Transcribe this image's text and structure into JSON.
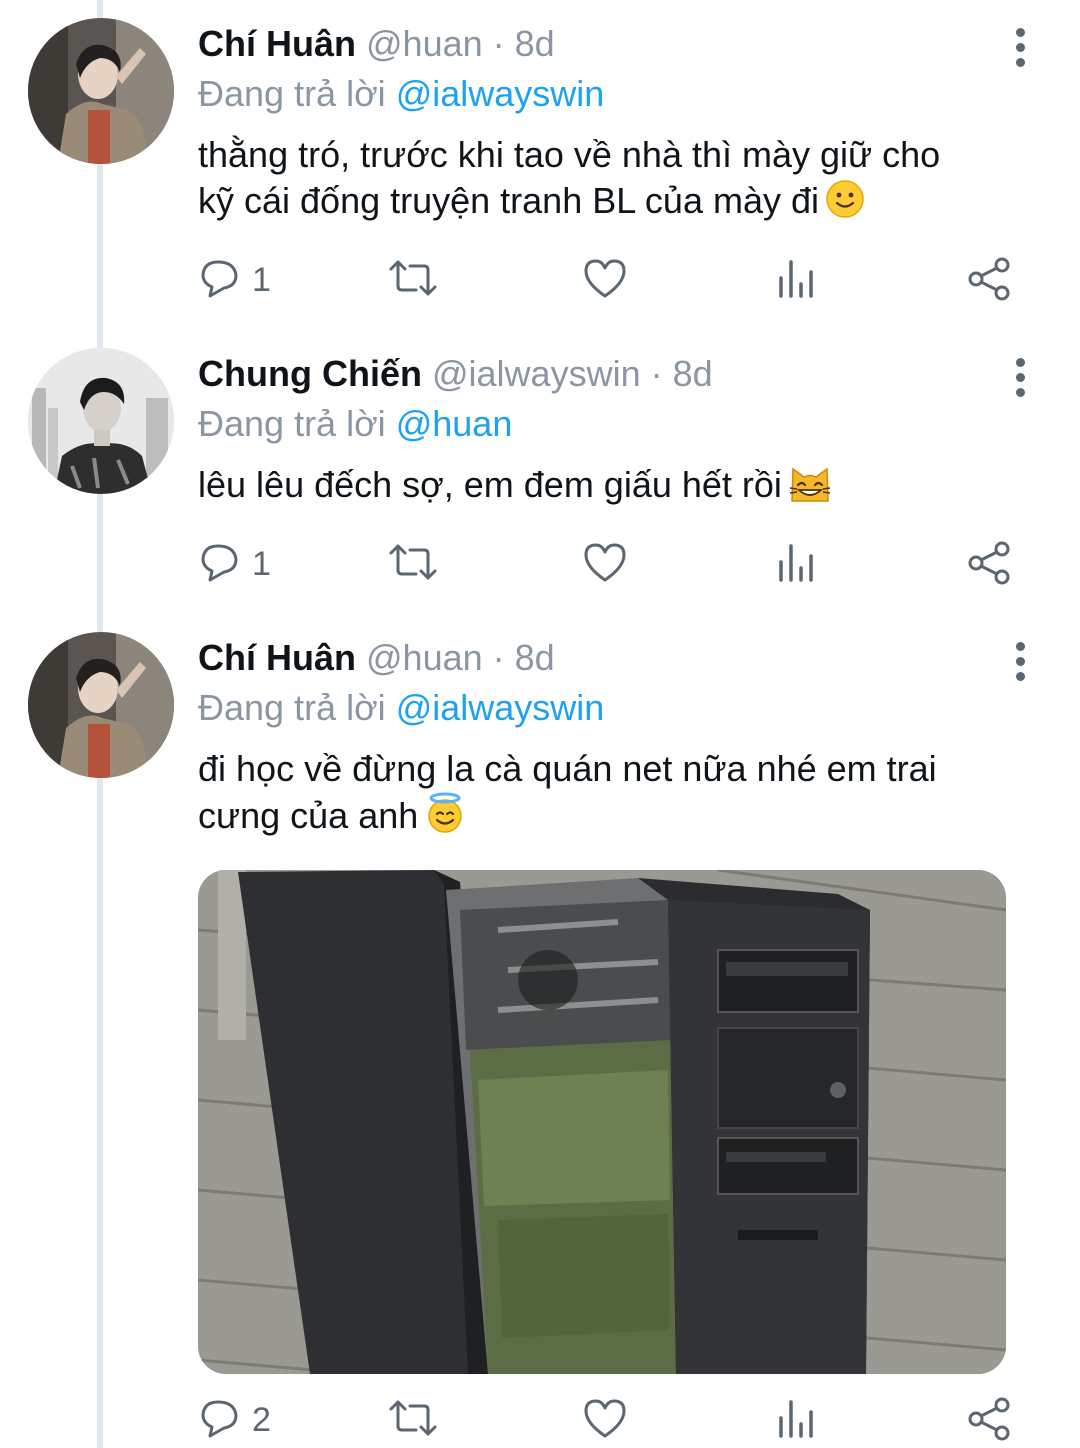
{
  "tweets": [
    {
      "name": "Chí Huân",
      "handle": "@huan",
      "time": "· 8d",
      "replying_prefix": "Đang trả lời",
      "replying_to": "@ialwayswin",
      "text_lines": [
        "thằng tró, trước khi tao về nhà thì mày giữ cho",
        "kỹ cái đống truyện tranh BL của mày đi"
      ],
      "emoji": "slightly-smiling-face-emoji",
      "reply_count": "1"
    },
    {
      "name": "Chung Chiến",
      "handle": "@ialwayswin",
      "time": "· 8d",
      "replying_prefix": "Đang trả lời",
      "replying_to": "@huan",
      "text_lines": [
        "lêu lêu đếch sợ, em đem giấu hết rồi"
      ],
      "emoji": "grinning-cat-emoji",
      "reply_count": "1"
    },
    {
      "name": "Chí Huân",
      "handle": "@huan",
      "time": "· 8d",
      "replying_prefix": "Đang trả lời",
      "replying_to": "@ialwayswin",
      "text_lines": [
        "đi học về đừng la cà quán net nữa nhé em trai",
        "cưng của anh"
      ],
      "emoji": "smiling-face-with-halo-emoji",
      "media": "photo-open-pc-case-with-ammo-box",
      "reply_count": "2"
    }
  ],
  "icons": {
    "reply": "reply-icon",
    "retweet": "retweet-icon",
    "like": "heart-icon",
    "analytics": "analytics-icon",
    "share": "share-icon",
    "more": "more-vertical-icon"
  },
  "colors": {
    "mention": "#1da1f2",
    "meta": "#8a96a3",
    "icon": "#5b6670",
    "thread_line": "#e1e8ed"
  }
}
